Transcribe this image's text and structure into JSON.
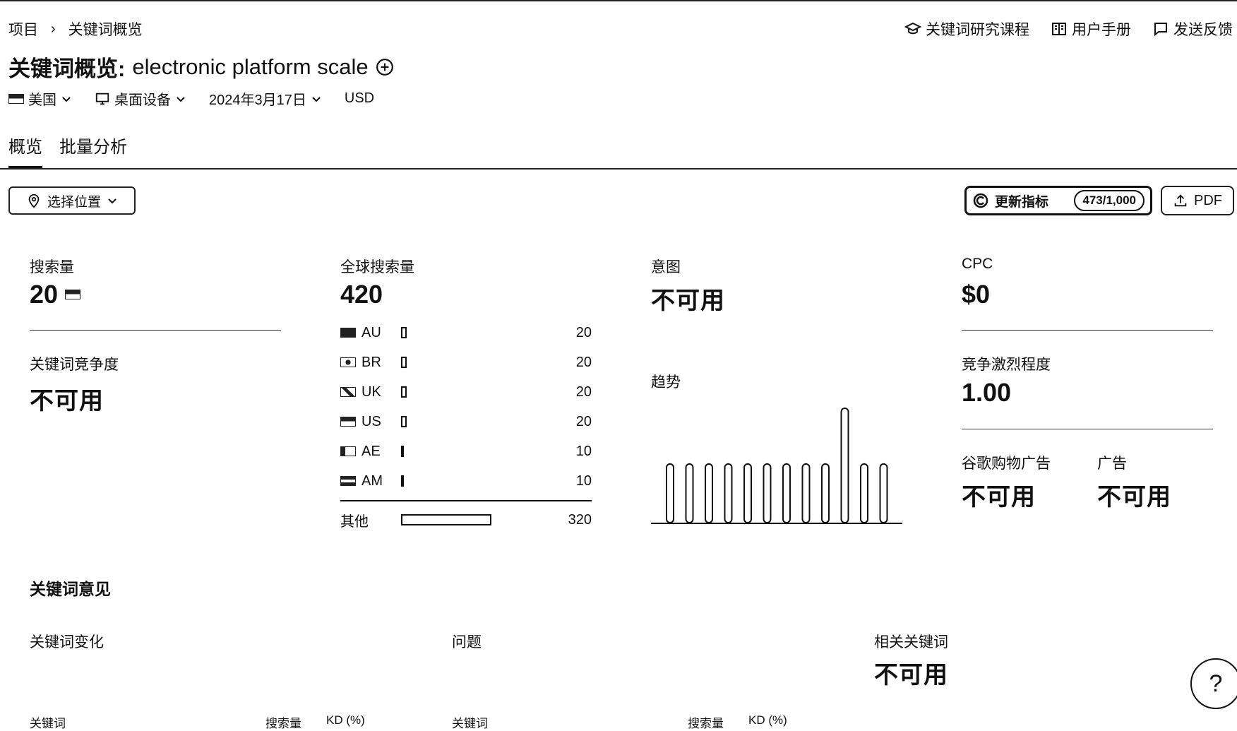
{
  "breadcrumb": {
    "root": "项目",
    "sep": "›",
    "current": "关键词概览"
  },
  "top_links": {
    "course": "关键词研究课程",
    "manual": "用户手册",
    "feedback": "发送反馈"
  },
  "title": {
    "prefix": "关键词概览:",
    "keyword": "electronic platform scale"
  },
  "filters": {
    "country": "美国",
    "device": "桌面设备",
    "date": "2024年3月17日",
    "currency": "USD"
  },
  "tabs": [
    "概览",
    "批量分析"
  ],
  "location_btn": "选择位置",
  "metrics_btn": {
    "label": "更新指标",
    "quota": "473/1,000"
  },
  "pdf_btn": "PDF",
  "volume": {
    "label": "搜索量",
    "value": "20"
  },
  "kd": {
    "label": "关键词竞争度",
    "value": "不可用"
  },
  "global": {
    "label": "全球搜索量",
    "value": "420",
    "countries": [
      {
        "code": "AU",
        "value": 20
      },
      {
        "code": "BR",
        "value": 20
      },
      {
        "code": "UK",
        "value": 20
      },
      {
        "code": "US",
        "value": 20
      },
      {
        "code": "AE",
        "value": 10
      },
      {
        "code": "AM",
        "value": 10
      }
    ],
    "other": {
      "label": "其他",
      "value": 320
    }
  },
  "intent": {
    "label": "意图",
    "value": "不可用"
  },
  "trend": {
    "label": "趋势",
    "values": [
      1,
      1,
      1,
      1,
      1,
      1,
      1,
      1,
      1,
      1.95,
      1,
      1
    ]
  },
  "cpc": {
    "label": "CPC",
    "value": "$0"
  },
  "competition": {
    "label": "竞争激烈程度",
    "value": "1.00"
  },
  "shopping": {
    "label": "谷歌购物广告",
    "value": "不可用"
  },
  "ads": {
    "label": "广告",
    "value": "不可用"
  },
  "ideas": {
    "title": "关键词意见",
    "variations": "关键词变化",
    "questions": "问题",
    "related": {
      "label": "相关关键词",
      "value": "不可用"
    },
    "col_keyword": "关键词",
    "col_volume": "搜索量",
    "col_kd": "KD (%)"
  },
  "help": "?"
}
